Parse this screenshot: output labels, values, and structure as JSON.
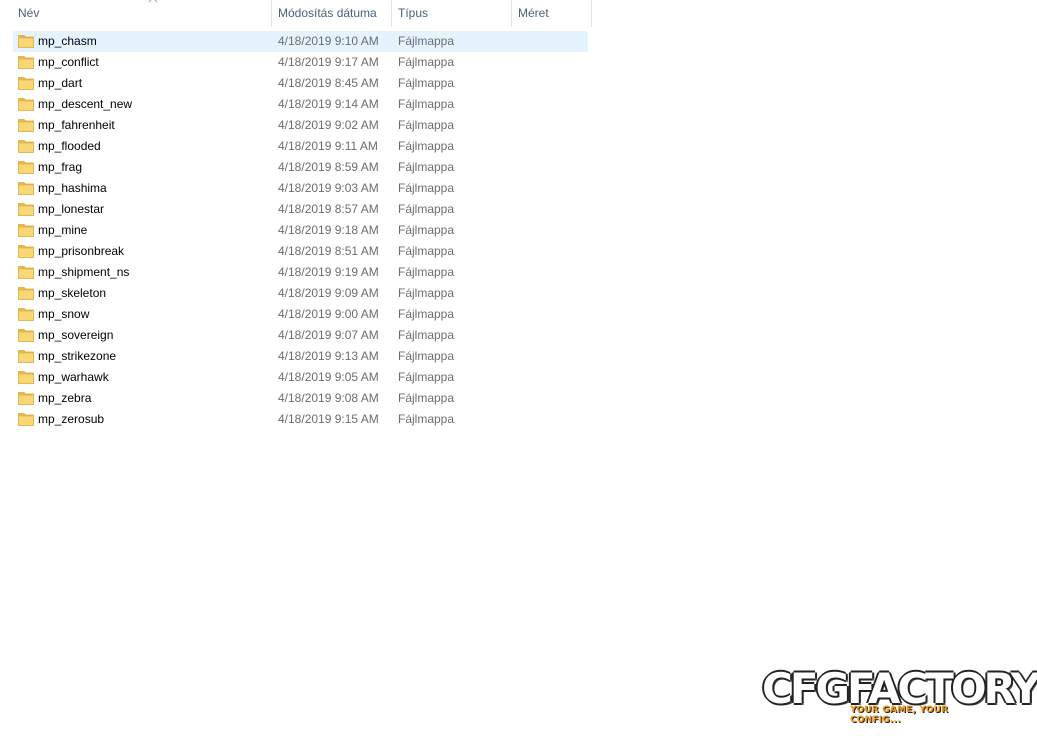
{
  "columns": {
    "name": "Név",
    "date": "Módosítás dátuma",
    "type": "Típus",
    "size": "Méret"
  },
  "icons": {
    "sort": "chevron-up-icon",
    "folder": "folder-icon"
  },
  "colors": {
    "selected_row": "#e5f3ff",
    "folder": "#f8d775",
    "header_text": "#4c607a",
    "logo_accent": "#f29b1e"
  },
  "files": [
    {
      "name": "mp_chasm",
      "date": "4/18/2019 9:10 AM",
      "type": "Fájlmappa",
      "size": "",
      "selected": true
    },
    {
      "name": "mp_conflict",
      "date": "4/18/2019 9:17 AM",
      "type": "Fájlmappa",
      "size": ""
    },
    {
      "name": "mp_dart",
      "date": "4/18/2019 8:45 AM",
      "type": "Fájlmappa",
      "size": ""
    },
    {
      "name": "mp_descent_new",
      "date": "4/18/2019 9:14 AM",
      "type": "Fájlmappa",
      "size": ""
    },
    {
      "name": "mp_fahrenheit",
      "date": "4/18/2019 9:02 AM",
      "type": "Fájlmappa",
      "size": ""
    },
    {
      "name": "mp_flooded",
      "date": "4/18/2019 9:11 AM",
      "type": "Fájlmappa",
      "size": ""
    },
    {
      "name": "mp_frag",
      "date": "4/18/2019 8:59 AM",
      "type": "Fájlmappa",
      "size": ""
    },
    {
      "name": "mp_hashima",
      "date": "4/18/2019 9:03 AM",
      "type": "Fájlmappa",
      "size": ""
    },
    {
      "name": "mp_lonestar",
      "date": "4/18/2019 8:57 AM",
      "type": "Fájlmappa",
      "size": ""
    },
    {
      "name": "mp_mine",
      "date": "4/18/2019 9:18 AM",
      "type": "Fájlmappa",
      "size": ""
    },
    {
      "name": "mp_prisonbreak",
      "date": "4/18/2019 8:51 AM",
      "type": "Fájlmappa",
      "size": ""
    },
    {
      "name": "mp_shipment_ns",
      "date": "4/18/2019 9:19 AM",
      "type": "Fájlmappa",
      "size": ""
    },
    {
      "name": "mp_skeleton",
      "date": "4/18/2019 9:09 AM",
      "type": "Fájlmappa",
      "size": ""
    },
    {
      "name": "mp_snow",
      "date": "4/18/2019 9:00 AM",
      "type": "Fájlmappa",
      "size": ""
    },
    {
      "name": "mp_sovereign",
      "date": "4/18/2019 9:07 AM",
      "type": "Fájlmappa",
      "size": ""
    },
    {
      "name": "mp_strikezone",
      "date": "4/18/2019 9:13 AM",
      "type": "Fájlmappa",
      "size": ""
    },
    {
      "name": "mp_warhawk",
      "date": "4/18/2019 9:05 AM",
      "type": "Fájlmappa",
      "size": ""
    },
    {
      "name": "mp_zebra",
      "date": "4/18/2019 9:08 AM",
      "type": "Fájlmappa",
      "size": ""
    },
    {
      "name": "mp_zerosub",
      "date": "4/18/2019 9:15 AM",
      "type": "Fájlmappa",
      "size": ""
    }
  ],
  "watermark": {
    "main": "CFGFACTORY",
    "tagline": "YOUR GAME, YOUR CONFIG..."
  }
}
